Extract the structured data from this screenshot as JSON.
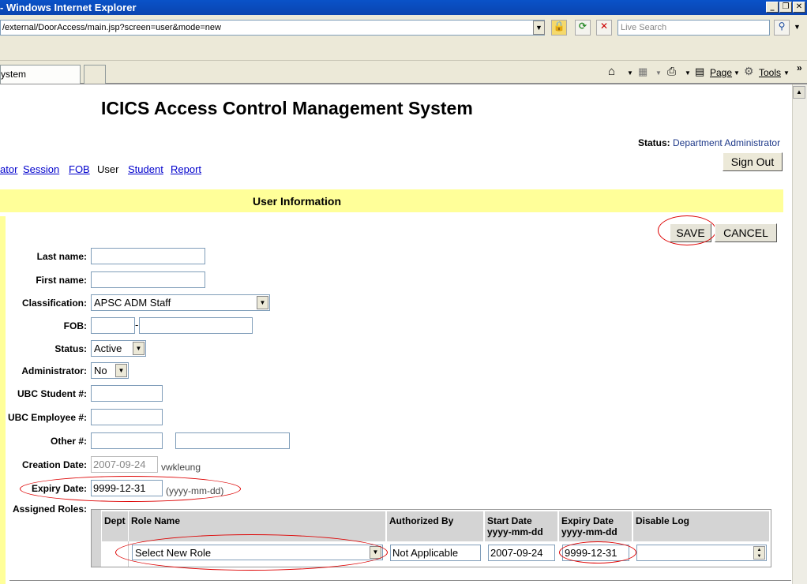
{
  "browser": {
    "title": "- Windows Internet Explorer",
    "address": "/external/DoorAccess/main.jsp?screen=user&mode=new",
    "search_placeholder": "Live Search",
    "tab_label": "ystem",
    "commands": {
      "page": "Page",
      "tools": "Tools"
    }
  },
  "page": {
    "heading": "ICICS Access Control Management System",
    "status_label": "Status:",
    "status_value": "Department Administrator",
    "sign_out": "Sign Out",
    "nav": [
      "ator",
      "Session",
      "FOB",
      "User",
      "Student",
      "Report"
    ],
    "section_title": "User Information",
    "save": "SAVE",
    "cancel": "CANCEL"
  },
  "form": {
    "last_name": {
      "label": "Last name:",
      "value": ""
    },
    "first_name": {
      "label": "First name:",
      "value": ""
    },
    "classification": {
      "label": "Classification:",
      "value": "APSC ADM Staff"
    },
    "fob": {
      "label": "FOB:",
      "separator": "-",
      "value1": "",
      "value2": ""
    },
    "status": {
      "label": "Status:",
      "value": "Active"
    },
    "administrator": {
      "label": "Administrator:",
      "value": "No"
    },
    "ubc_student": {
      "label": "UBC Student #:",
      "value": ""
    },
    "ubc_employee": {
      "label": "UBC Employee #:",
      "value": ""
    },
    "other": {
      "label": "Other #:",
      "value1": "",
      "value2": ""
    },
    "creation_date": {
      "label": "Creation Date:",
      "value": "2007-09-24",
      "user": "vwkleung"
    },
    "expiry_date": {
      "label": "Expiry Date:",
      "value": "9999-12-31",
      "hint": "(yyyy-mm-dd)"
    },
    "assigned_roles_label": "Assigned Roles:"
  },
  "roles_table": {
    "headers": {
      "dept": "Dept",
      "role_name": "Role Name",
      "authorized_by": "Authorized By",
      "start_date": "Start Date",
      "start_fmt": "yyyy-mm-dd",
      "expiry_date": "Expiry Date",
      "expiry_fmt": "yyyy-mm-dd",
      "disable_log": "Disable Log"
    },
    "row": {
      "role": "Select New Role",
      "authorized_by": "Not Applicable",
      "start_date": "2007-09-24",
      "expiry_date": "9999-12-31",
      "disable_log": ""
    }
  }
}
